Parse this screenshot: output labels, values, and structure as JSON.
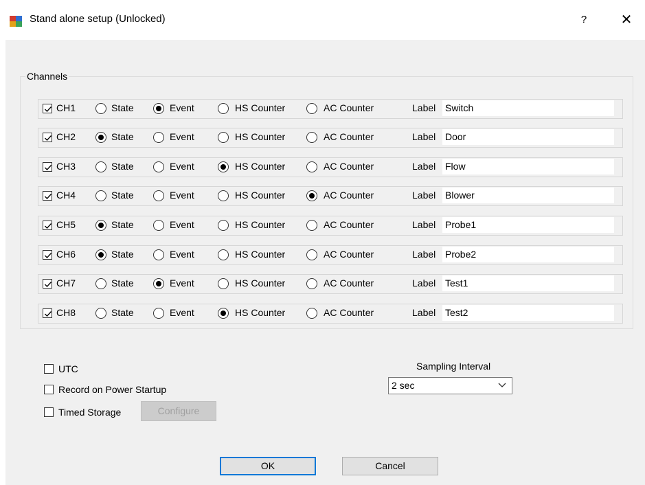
{
  "window": {
    "title": "Stand alone setup (Unlocked)",
    "help_label": "?",
    "close_label": "✕"
  },
  "channels": {
    "group_title": "Channels",
    "label_caption": "Label",
    "options": [
      "State",
      "Event",
      "HS Counter",
      "AC Counter"
    ],
    "rows": [
      {
        "name": "CH1",
        "checked": true,
        "selected": "Event",
        "label": "Switch"
      },
      {
        "name": "CH2",
        "checked": true,
        "selected": "State",
        "label": "Door"
      },
      {
        "name": "CH3",
        "checked": true,
        "selected": "HS Counter",
        "label": "Flow"
      },
      {
        "name": "CH4",
        "checked": true,
        "selected": "AC Counter",
        "label": "Blower"
      },
      {
        "name": "CH5",
        "checked": true,
        "selected": "State",
        "label": "Probe1"
      },
      {
        "name": "CH6",
        "checked": true,
        "selected": "State",
        "label": "Probe2"
      },
      {
        "name": "CH7",
        "checked": true,
        "selected": "Event",
        "label": "Test1"
      },
      {
        "name": "CH8",
        "checked": true,
        "selected": "HS Counter",
        "label": "Test2"
      }
    ]
  },
  "options": {
    "utc_label": "UTC",
    "utc_checked": false,
    "record_label": "Record on Power Startup",
    "record_checked": false,
    "timed_label": "Timed Storage",
    "timed_checked": false,
    "configure_label": "Configure"
  },
  "sampling": {
    "title": "Sampling Interval",
    "value": "2 sec"
  },
  "buttons": {
    "ok": "OK",
    "cancel": "Cancel"
  }
}
